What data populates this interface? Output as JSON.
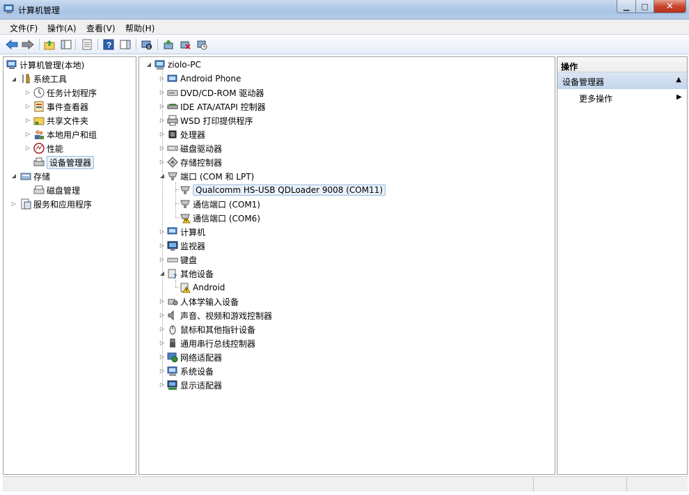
{
  "window": {
    "title": "计算机管理"
  },
  "menu": {
    "file": "文件(F)",
    "action": "操作(A)",
    "view": "查看(V)",
    "help": "帮助(H)"
  },
  "left_tree": {
    "root": "计算机管理(本地)",
    "system_tools": "系统工具",
    "task_scheduler": "任务计划程序",
    "event_viewer": "事件查看器",
    "shared_folders": "共享文件夹",
    "local_users": "本地用户和组",
    "performance": "性能",
    "device_manager": "设备管理器",
    "storage": "存储",
    "disk_management": "磁盘管理",
    "services_apps": "服务和应用程序"
  },
  "device_tree": {
    "computer": "ziolo-PC",
    "categories": [
      {
        "label": "Android Phone",
        "icon": "phone-icon"
      },
      {
        "label": "DVD/CD-ROM 驱动器",
        "icon": "dvd-drive-icon"
      },
      {
        "label": "IDE ATA/ATAPI 控制器",
        "icon": "ide-controller-icon"
      },
      {
        "label": "WSD 打印提供程序",
        "icon": "printer-icon"
      },
      {
        "label": "处理器",
        "icon": "processor-icon"
      },
      {
        "label": "磁盘驱动器",
        "icon": "disk-drive-icon"
      },
      {
        "label": "存储控制器",
        "icon": "storage-controller-icon"
      },
      {
        "label": "端口 (COM 和 LPT)",
        "icon": "port-icon"
      },
      {
        "label": "计算机",
        "icon": "computer-icon"
      },
      {
        "label": "监视器",
        "icon": "monitor-icon"
      },
      {
        "label": "键盘",
        "icon": "keyboard-icon"
      },
      {
        "label": "其他设备",
        "icon": "other-devices-icon"
      },
      {
        "label": "人体学输入设备",
        "icon": "hid-icon"
      },
      {
        "label": "声音、视频和游戏控制器",
        "icon": "speaker-icon"
      },
      {
        "label": "鼠标和其他指针设备",
        "icon": "mouse-icon"
      },
      {
        "label": "通用串行总线控制器",
        "icon": "usb-icon"
      },
      {
        "label": "网络适配器",
        "icon": "network-adapter-icon"
      },
      {
        "label": "系统设备",
        "icon": "system-devices-icon"
      },
      {
        "label": "显示适配器",
        "icon": "display-adapter-icon"
      }
    ],
    "ports_children": [
      "Qualcomm HS-USB QDLoader 9008 (COM11)",
      "通信端口 (COM1)",
      "通信端口 (COM6)"
    ],
    "other_children": [
      "Android"
    ]
  },
  "actions": {
    "header": "操作",
    "section": "设备管理器",
    "more": "更多操作"
  }
}
